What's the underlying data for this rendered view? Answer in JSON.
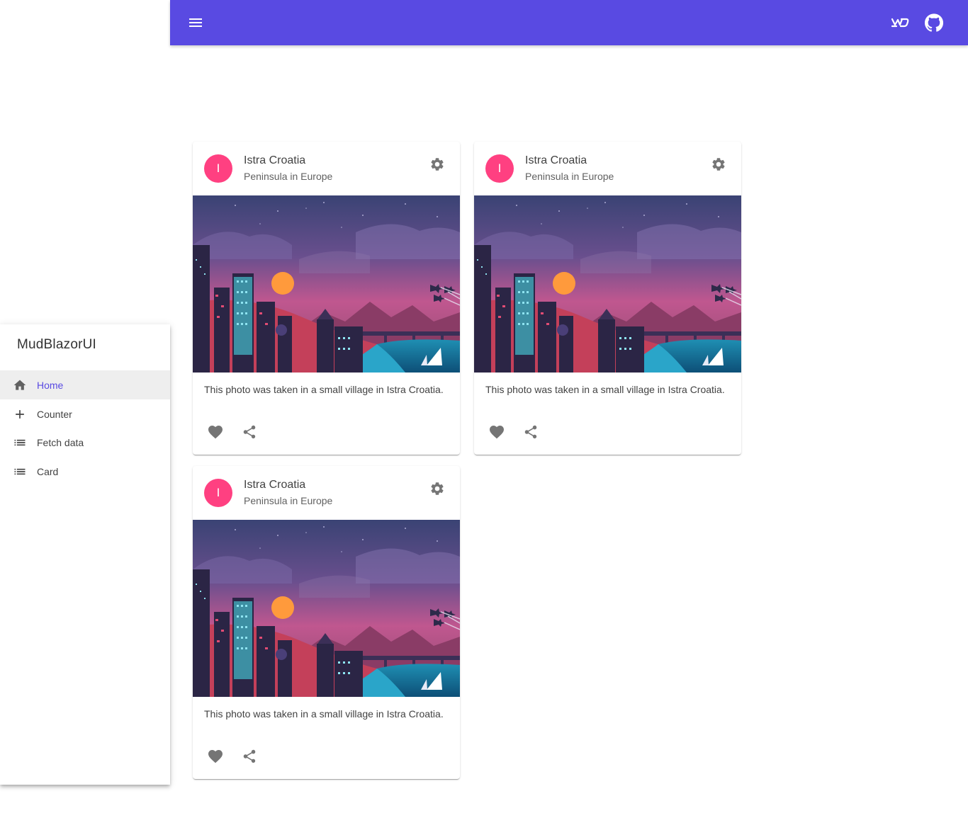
{
  "colors": {
    "primary": "#594ae2",
    "avatar": "#ff4081",
    "icon_grey": "#757575"
  },
  "appbar": {
    "menu_icon": "hamburger-menu-icon",
    "mudblazor_icon": "mudblazor-logo-icon",
    "github_icon": "github-icon"
  },
  "drawer": {
    "brand": "MudBlazorUI",
    "items": [
      {
        "label": "Home",
        "icon": "home-icon",
        "active": true
      },
      {
        "label": "Counter",
        "icon": "plus-icon",
        "active": false
      },
      {
        "label": "Fetch data",
        "icon": "list-icon",
        "active": false
      },
      {
        "label": "Card",
        "icon": "list-icon",
        "active": false
      }
    ]
  },
  "cards": [
    {
      "avatar": "I",
      "title": "Istra Croatia",
      "subtitle": "Peninsula in Europe",
      "text": "This photo was taken in a small village in Istra Croatia."
    },
    {
      "avatar": "I",
      "title": "Istra Croatia",
      "subtitle": "Peninsula in Europe",
      "text": "This photo was taken in a small village in Istra Croatia."
    },
    {
      "avatar": "I",
      "title": "Istra Croatia",
      "subtitle": "Peninsula in Europe",
      "text": "This photo was taken in a small village in Istra Croatia."
    }
  ]
}
